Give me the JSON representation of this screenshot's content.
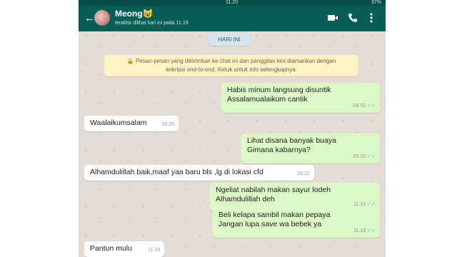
{
  "status_bar": {
    "time": "11.20",
    "battery": "37%"
  },
  "header": {
    "back_glyph": "←",
    "contact_name": "Meong😺",
    "last_seen": "terakhir dilihat hari ini pada 11.19",
    "icons": [
      "video-call-icon",
      "phone-icon",
      "more-vert-icon"
    ]
  },
  "chat": {
    "date_chip": "HARI INI",
    "encryption_notice": {
      "line1": "🔒 Pesan-pesan yang dikirimkan ke chat ini dan panggilan kini diamankan dengan",
      "line2": "enkripsi end-to-end. Ketuk untuk info selengkapnya."
    },
    "messages": [
      {
        "dir": "out",
        "lines": [
          "Habis minum langsung disuntik",
          "Assalamualaikum cantik"
        ],
        "time": "08.52",
        "ticks": "✓✓"
      },
      {
        "dir": "in",
        "lines": [
          "Waalaikumsalam"
        ],
        "time": "09.20"
      },
      {
        "dir": "out",
        "lines": [
          "Lihat disana banyak buaya",
          "Gimana kabarnya?"
        ],
        "time": "09.22",
        "ticks": "✓✓"
      },
      {
        "dir": "in",
        "lines": [
          "Alhamdulillah baik,maaf yaa baru bls ,lg di lokasi cfd"
        ],
        "time": "08.22"
      },
      {
        "dir": "out",
        "lines": [
          "Ngeliat nabilah makan sayur lodeh",
          "Alhamdulillah deh"
        ],
        "time": "11.16",
        "ticks": "✓✓"
      },
      {
        "dir": "out",
        "lines": [
          "Beli kelapa sambil makan pepaya",
          "Jangan lupa save wa bebek ya"
        ],
        "time": "11.18",
        "ticks": "✓✓"
      },
      {
        "dir": "in",
        "lines": [
          "Pantun mulu"
        ],
        "time": "11.18"
      }
    ]
  },
  "colors": {
    "header": "#075e54",
    "outgoing_bubble": "#dcf8c6",
    "incoming_bubble": "#ffffff",
    "chat_bg": "#e5ddd5",
    "read_tick": "#4fc3f7"
  }
}
